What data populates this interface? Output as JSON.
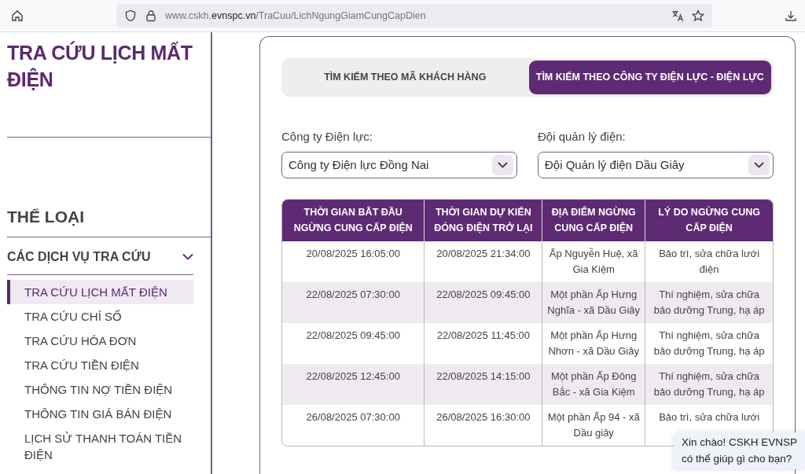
{
  "browser": {
    "url": "www.cskh.**evnspc.vn**/TraCuu/LichNgungGiamCungCapDien"
  },
  "sidebar": {
    "title": "TRA CỨU LỊCH MẤT ĐIỆN",
    "category_heading": "THỂ LOẠI",
    "group": {
      "label": "CÁC DỊCH VỤ TRA CỨU",
      "expanded": true
    },
    "items": [
      {
        "label": "TRA CỨU LỊCH MẤT ĐIỆN",
        "selected": true
      },
      {
        "label": "TRA CỨU CHỈ SỐ",
        "selected": false
      },
      {
        "label": "TRA CỨU HÓA ĐƠN",
        "selected": false
      },
      {
        "label": "TRA CỨU TIỀN ĐIỆN",
        "selected": false
      },
      {
        "label": "THÔNG TIN NỢ TIỀN ĐIỆN",
        "selected": false
      },
      {
        "label": "THÔNG TIN GIÁ BÁN ĐIỆN",
        "selected": false
      },
      {
        "label": "LỊCH SỬ THANH TOÁN TIỀN ĐIỆN",
        "selected": false
      }
    ]
  },
  "tabs": [
    {
      "label": "TÌM KIẾM THEO MÃ KHÁCH HÀNG",
      "selected": false
    },
    {
      "label": "TÌM KIẾM THEO CÔNG TY ĐIỆN LỰC - ĐIỆN LỰC",
      "selected": true
    }
  ],
  "filters": [
    {
      "label": "Công ty Điện lực:",
      "value": "Công ty Điện lực Đồng Nai"
    },
    {
      "label": "Đội quản lý điện:",
      "value": "Đội Quản lý điện Dầu Giây"
    }
  ],
  "table": {
    "columns": [
      "THỜI GIAN BẮT ĐẦU NGỪNG CUNG CẤP ĐIỆN",
      "THỜI GIAN DỰ KIẾN ĐÓNG ĐIỆN TRỞ LẠI",
      "ĐỊA ĐIỂM NGỪNG CUNG CẤP ĐIỆN",
      "LÝ DO NGỪNG CUNG CẤP ĐIỆN"
    ],
    "rows": [
      [
        "20/08/2025 16:05:00",
        "20/08/2025 21:34:00",
        "Ấp Nguyễn Huệ, xã Gia Kiệm",
        "Bảo trì, sửa chữa lưới điện"
      ],
      [
        "22/08/2025 07:30:00",
        "22/08/2025 09:45:00",
        "Một phần Ấp Hưng Nghĩa - xã Dầu Giây",
        "Thí nghiệm, sửa chữa bảo dưỡng Trung, hạ áp"
      ],
      [
        "22/08/2025 09:45:00",
        "22/08/2025 11:45:00",
        "Một phần Ấp Hưng Nhơn - xã Dầu Giây",
        "Thí nghiệm, sửa chữa bảo dưỡng Trung, hạ áp"
      ],
      [
        "22/08/2025 12:45:00",
        "22/08/2025 14:15:00",
        "Một phần Ấp Đông Bắc - xã Gia Kiệm",
        "Thí nghiệm, sửa chữa bảo dưỡng Trung, hạ áp"
      ],
      [
        "26/08/2025 07:30:00",
        "26/08/2025 16:30:00",
        "Một phần Ấp 94 - xã Dầu giây",
        "Bảo trì, sửa chữa lưới"
      ]
    ]
  },
  "chat_bubble": {
    "lines": [
      "Xin chào! CSKH EVNSP",
      "có thể giúp gì cho bạn?"
    ]
  }
}
